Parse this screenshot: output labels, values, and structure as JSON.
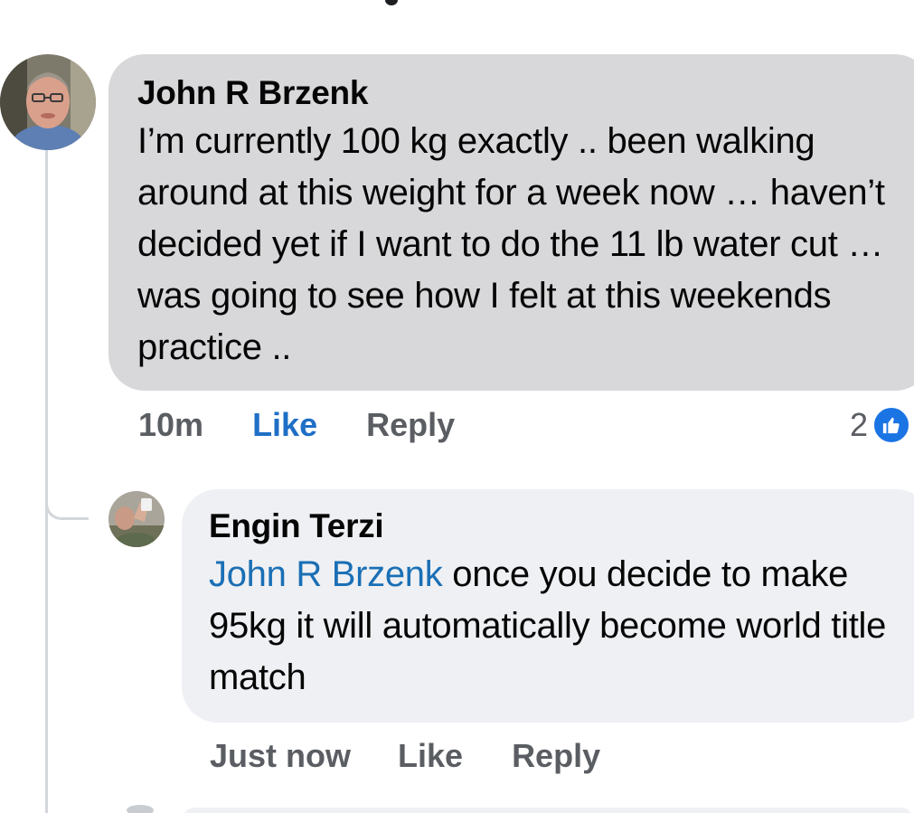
{
  "thread": {
    "comment": {
      "author": "John R Brzenk",
      "text": "I’m currently 100 kg exactly .. been walking around at this weight for a week now … haven’t decided yet if I want to do the 11 lb water cut … was going to see how I felt at this weekends practice ..",
      "time": "10m",
      "like_label": "Like",
      "reply_label": "Reply",
      "reaction_count": "2",
      "reaction_icon": "thumbs-up-icon",
      "like_color": "#1f6fc6"
    },
    "reply": {
      "author": "Engin Terzi",
      "mention": "John R Brzenk",
      "text": " once you decide to make 95kg it will automatically become world title match",
      "time": "Just now",
      "like_label": "Like",
      "reply_label": "Reply",
      "mention_color": "#1a6fb5"
    }
  }
}
